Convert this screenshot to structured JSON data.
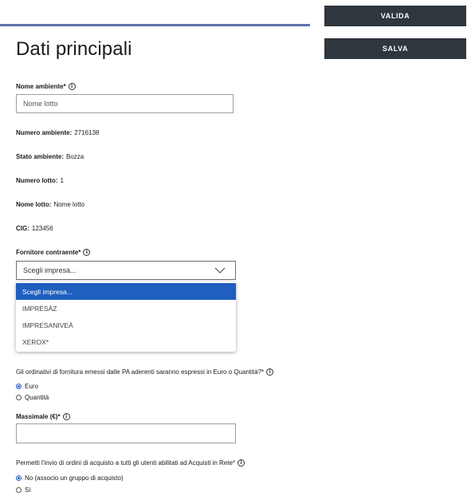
{
  "header": {
    "valida_label": "VALIDA",
    "salva_label": "SALVA"
  },
  "page_title": "Dati principali",
  "nome_ambiente": {
    "label": "Nome ambiente*",
    "value": "Nome lotto"
  },
  "info": {
    "numero_ambiente": {
      "label": "Numero ambiente:",
      "value": "2716138"
    },
    "stato_ambiente": {
      "label": "Stato ambiente:",
      "value": "Bozza"
    },
    "numero_lotto": {
      "label": "Numero lotto:",
      "value": "1"
    },
    "nome_lotto": {
      "label": "Nome lotto:",
      "value": "Nome lotto"
    },
    "cig": {
      "label": "CIG:",
      "value": "123456"
    }
  },
  "fornitore": {
    "label": "Fornitore contraente*",
    "selected": "Scegli impresa...",
    "options": [
      "Scegli impresa...",
      "IMPRÉSÀZ",
      "IMPRESANIVEÀ",
      "XEROX*"
    ]
  },
  "ordinativi": {
    "question": "Gli ordinativi di fornitura emessi dalle PA aderenti saranno espressi in Euro o Quantità?*",
    "options": [
      "Euro",
      "Quantità"
    ],
    "selected": "Euro"
  },
  "massimale": {
    "label": "Massimale (€)*",
    "value": ""
  },
  "permetti": {
    "question": "Permetti l'invio di ordini di acquisto a tutti gli utenti abilitati ad Acquisti in Rete*",
    "options": [
      "No (associo un gruppo di acquisto)",
      "Sì"
    ],
    "selected": "No (associo un gruppo di acquisto)"
  },
  "colors": {
    "primary": "#1f5fbf",
    "dark_button": "#2f363d",
    "rule": "#5b70a8"
  },
  "icons": [
    "info-icon",
    "chevron-down-icon"
  ]
}
